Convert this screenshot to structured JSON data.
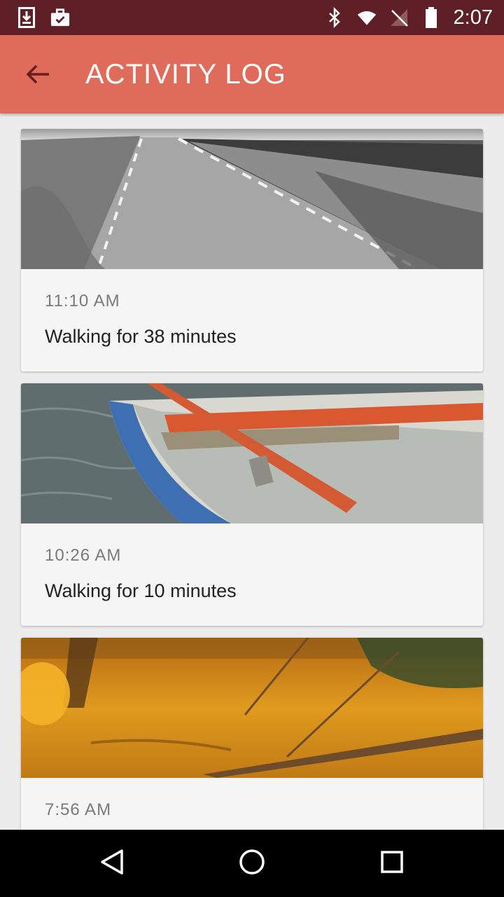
{
  "status_bar": {
    "time": "2:07",
    "left_icons": [
      "download-icon",
      "briefcase-check-icon"
    ],
    "right_icons": [
      "bluetooth-icon",
      "wifi-icon",
      "no-signal-icon",
      "battery-icon"
    ]
  },
  "app_bar": {
    "title": "ACTIVITY LOG",
    "back_icon": "arrow-back-icon",
    "background_color": "#df6b5b"
  },
  "activities": [
    {
      "time": "11:10 AM",
      "description": "Walking for 38 minutes",
      "image": "road-photo"
    },
    {
      "time": "10:26 AM",
      "description": "Walking for 10 minutes",
      "image": "boat-photo"
    },
    {
      "time": "7:56 AM",
      "description": "",
      "image": "autumn-pond-photo"
    }
  ],
  "nav_bar": {
    "icons": [
      "back-triangle-icon",
      "home-circle-icon",
      "recents-square-icon"
    ]
  }
}
